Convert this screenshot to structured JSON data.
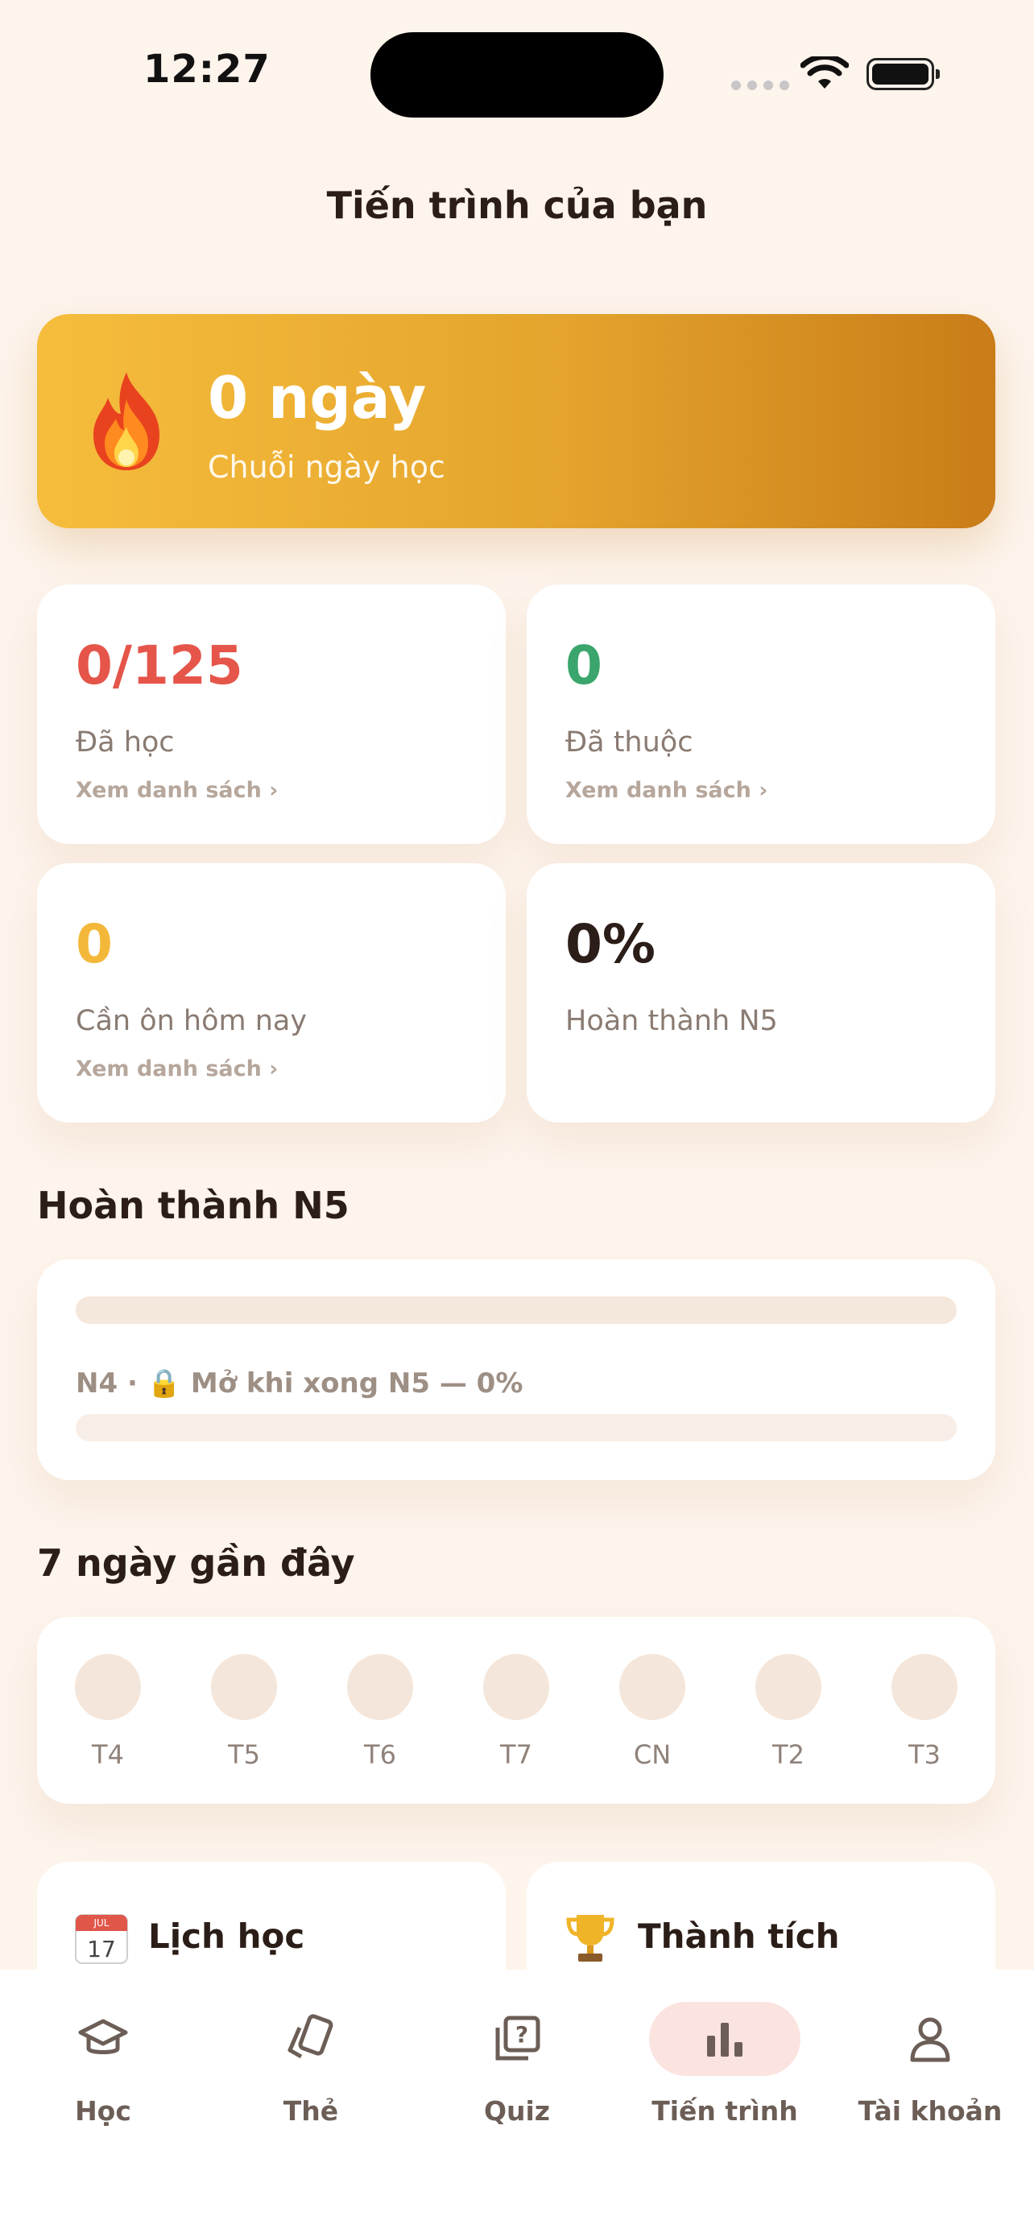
{
  "status": {
    "time": "12:27"
  },
  "header": {
    "title": "Tiến trình của bạn"
  },
  "streak": {
    "value": "0 ngày",
    "label": "Chuỗi ngày học",
    "icon": "fire-icon"
  },
  "stats": [
    {
      "value": "0/125",
      "label": "Đã học",
      "link": "Xem danh sách ›",
      "color": "#e5554a"
    },
    {
      "value": "0",
      "label": "Đã thuộc",
      "link": "Xem danh sách ›",
      "color": "#3aa56c"
    },
    {
      "value": "0",
      "label": "Cần ôn hôm nay",
      "link": "Xem danh sách ›",
      "color": "#f3b83a"
    },
    {
      "value": "0%",
      "label": "Hoàn thành N5",
      "color": "#2b1d17"
    }
  ],
  "level_section": {
    "title": "Hoàn thành N5",
    "n5_progress": 0,
    "n4_text": "N4 · 🔒 Mở khi xong N5 — 0%",
    "n4_progress": 0
  },
  "week_section": {
    "title": "7 ngày gần đây",
    "days": [
      "T4",
      "T5",
      "T6",
      "T7",
      "CN",
      "T2",
      "T3"
    ]
  },
  "bottom_cards": [
    {
      "label": "Lịch học",
      "icon": "calendar-icon",
      "icon_text": "17"
    },
    {
      "label": "Thành tích",
      "icon": "trophy-icon"
    }
  ],
  "tabs": [
    {
      "label": "Học",
      "icon": "graduation-cap-icon"
    },
    {
      "label": "Thẻ",
      "icon": "cards-icon"
    },
    {
      "label": "Quiz",
      "icon": "quiz-icon"
    },
    {
      "label": "Tiến trình",
      "icon": "bar-chart-icon",
      "active": true
    },
    {
      "label": "Tài khoản",
      "icon": "user-icon"
    }
  ]
}
